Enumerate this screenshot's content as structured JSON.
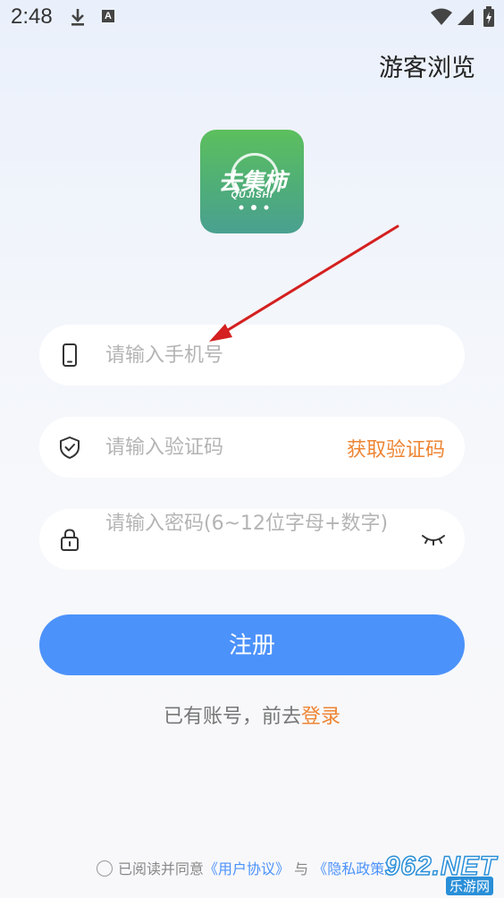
{
  "status_bar": {
    "time": "2:48",
    "indicator_a": "A"
  },
  "header": {
    "guest_link": "游客浏览"
  },
  "logo": {
    "text": "去集柿",
    "sub": "QUJISHI"
  },
  "form": {
    "phone_placeholder": "请输入手机号",
    "code_placeholder": "请输入验证码",
    "get_code_label": "获取验证码",
    "password_placeholder": "请输入密码(6~12位字母+数字)",
    "register_label": "注册"
  },
  "login": {
    "prefix": "已有账号，前去",
    "link": "登录"
  },
  "agreement": {
    "prefix": "已阅读并同意",
    "user_agreement": "《用户协议》",
    "conjunction": "与",
    "privacy_policy": "《隐私政策》"
  },
  "watermark": {
    "main": "962.NET",
    "sub": "乐游网"
  },
  "colors": {
    "accent": "#4c92fb",
    "highlight": "#ee8534",
    "logo_green": "#5cbf5d",
    "annotation_arrow": "#d42020"
  }
}
